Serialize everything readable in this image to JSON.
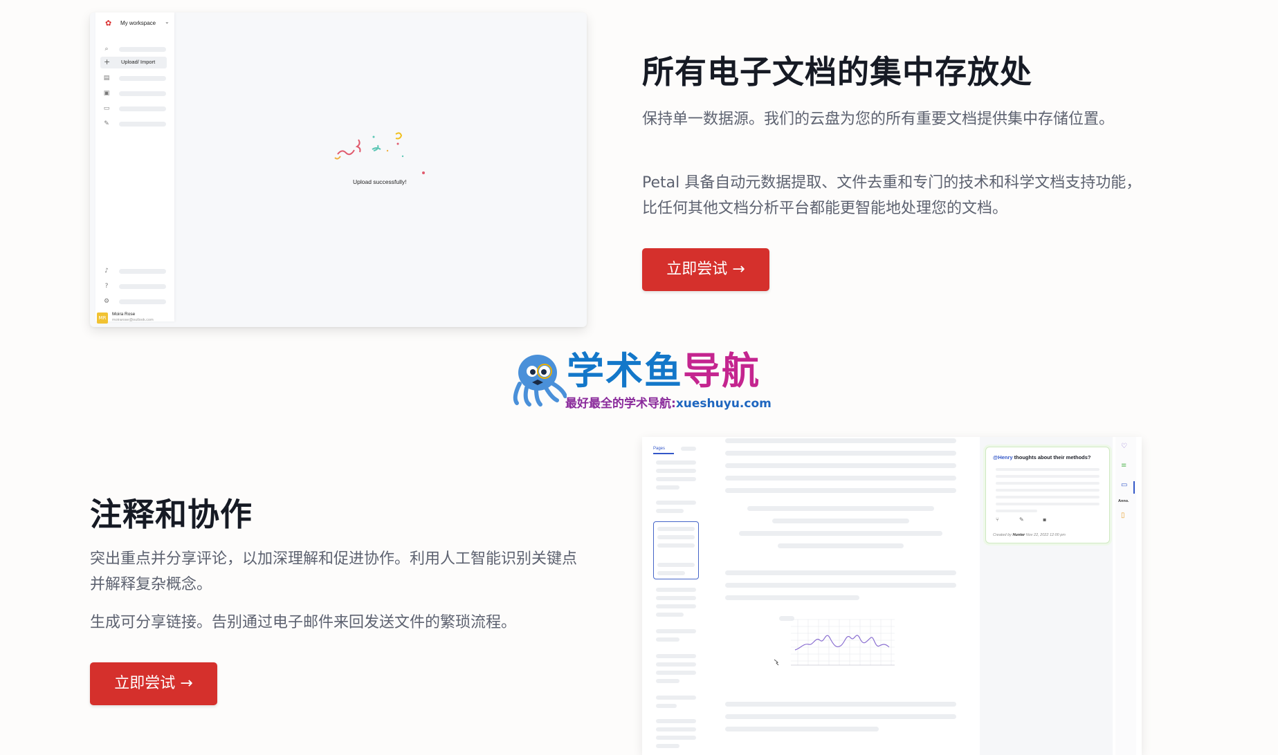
{
  "section1": {
    "title": "所有电子文档的集中存放处",
    "para1": "保持单一数据源。我们的云盘为您的所有重要文档提供集中存储位置。",
    "para2": "Petal 具备自动元数据提取、文件去重和专门的技术和科学文档支持功能，比任何其他文档分析平台都能更智能地处理您的文档。",
    "cta": "立即尝试 →"
  },
  "section2": {
    "title": "注释和协作",
    "para1": "突出重点并分享评论，以加深理解和促进协作。利用人工智能识别关键点并解释复杂概念。",
    "para2": "生成可分享链接。告别通过电子邮件来回发送文件的繁琐流程。",
    "cta": "立即尝试 →"
  },
  "mock_workspace": {
    "workspace_name": "My workspace",
    "upload_label": "Upload/ Import",
    "message": "Upload successfully!",
    "user_initials": "MR",
    "user_name": "Moira Rose",
    "user_email": "moirarose@outlook.com"
  },
  "mock_annotation": {
    "tab_label": "Pages",
    "comment_mention": "@Henry",
    "comment_title": "thoughts about their methods?",
    "created_prefix": "Created by",
    "created_user": "Hunter",
    "created_time": "Nov 22, 2022 12:00 pm",
    "rail_label": "Anno."
  },
  "watermark": {
    "title_part1": "学术鱼",
    "title_part2": "导航",
    "subtitle": "最好最全的学术导航:",
    "domain": "xueshuyu.com"
  },
  "colors": {
    "accent_red": "#d5302c",
    "heading": "#161a24",
    "body_text": "#5d6270",
    "link_blue": "#3357c8"
  }
}
